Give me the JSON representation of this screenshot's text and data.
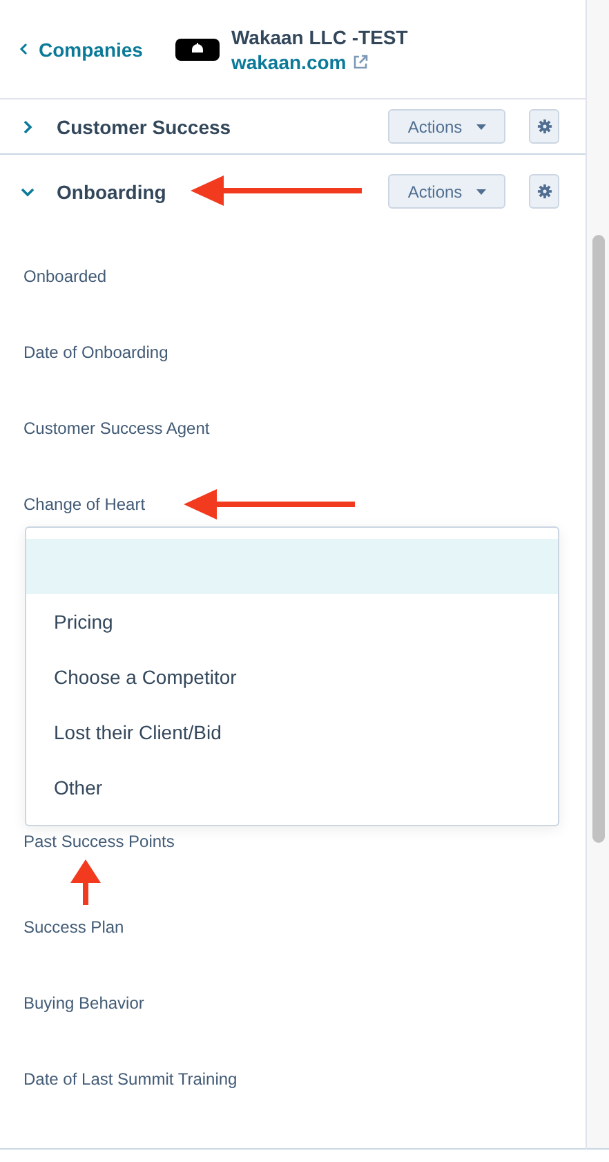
{
  "header": {
    "back_link": "Companies",
    "company_name": "Wakaan LLC -TEST",
    "domain": "wakaan.com"
  },
  "sections": [
    {
      "title": "Customer Success",
      "expanded": false,
      "actions": "Actions"
    },
    {
      "title": "Onboarding",
      "expanded": true,
      "actions": "Actions"
    }
  ],
  "fields": [
    {
      "label": "Onboarded"
    },
    {
      "label": "Date of Onboarding"
    },
    {
      "label": "Customer Success Agent"
    },
    {
      "label": "Change of Heart",
      "open_dropdown": true
    },
    {
      "label": "Past Success Points"
    },
    {
      "label": "Success Plan"
    },
    {
      "label": "Buying Behavior"
    },
    {
      "label": "Date of Last Summit Training"
    }
  ],
  "dropdown_options": [
    {
      "kind": "blank",
      "selected": true
    },
    {
      "kind": "option",
      "label": "Pricing",
      "selected": false
    },
    {
      "kind": "option",
      "label": "Choose a Competitor",
      "selected": false
    },
    {
      "kind": "option",
      "label": "Lost their Client/Bid",
      "selected": false
    },
    {
      "kind": "option",
      "label": "Other",
      "selected": false
    }
  ]
}
